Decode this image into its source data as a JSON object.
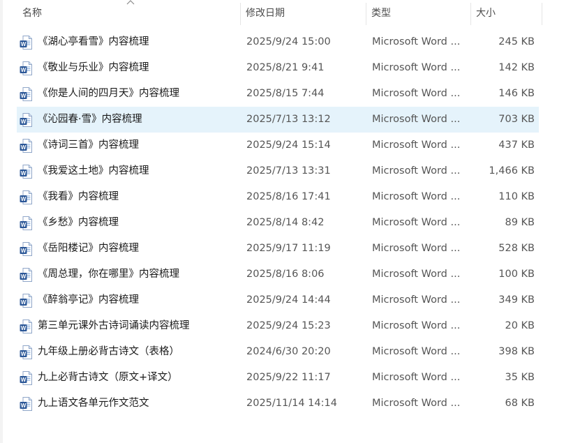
{
  "header": {
    "name": "名称",
    "date": "修改日期",
    "type": "类型",
    "size": "大小"
  },
  "icons": {
    "file": "word-document-icon",
    "sort": "sort-ascending-chevron-icon"
  },
  "colors": {
    "selected_row": "#e5f3fb",
    "word_blue": "#2b5797"
  },
  "selected_index": 3,
  "files": [
    {
      "name": "《湖心亭看雪》内容梳理",
      "date": "2025/9/24 15:00",
      "type": "Microsoft Word ...",
      "size": "245 KB"
    },
    {
      "name": "《敬业与乐业》内容梳理",
      "date": "2025/8/21 9:41",
      "type": "Microsoft Word ...",
      "size": "142 KB"
    },
    {
      "name": "《你是人间的四月天》内容梳理",
      "date": "2025/8/15 7:44",
      "type": "Microsoft Word ...",
      "size": "146 KB"
    },
    {
      "name": "《沁园春·雪》内容梳理",
      "date": "2025/7/13 13:12",
      "type": "Microsoft Word ...",
      "size": "703 KB"
    },
    {
      "name": "《诗词三首》内容梳理",
      "date": "2025/9/24 15:14",
      "type": "Microsoft Word ...",
      "size": "437 KB"
    },
    {
      "name": "《我爱这土地》内容梳理",
      "date": "2025/7/13 13:31",
      "type": "Microsoft Word ...",
      "size": "1,466 KB"
    },
    {
      "name": "《我看》内容梳理",
      "date": "2025/8/16 17:41",
      "type": "Microsoft Word ...",
      "size": "110 KB"
    },
    {
      "name": "《乡愁》内容梳理",
      "date": "2025/8/14 8:42",
      "type": "Microsoft Word ...",
      "size": "89 KB"
    },
    {
      "name": "《岳阳楼记》内容梳理",
      "date": "2025/9/17 11:19",
      "type": "Microsoft Word ...",
      "size": "528 KB"
    },
    {
      "name": "《周总理，你在哪里》内容梳理",
      "date": "2025/8/16 8:06",
      "type": "Microsoft Word ...",
      "size": "100 KB"
    },
    {
      "name": "《醉翁亭记》内容梳理",
      "date": "2025/9/24 14:44",
      "type": "Microsoft Word ...",
      "size": "349 KB"
    },
    {
      "name": "第三单元课外古诗词诵读内容梳理",
      "date": "2025/9/24 15:23",
      "type": "Microsoft Word ...",
      "size": "20 KB"
    },
    {
      "name": "九年级上册必背古诗文（表格）",
      "date": "2024/6/30 20:20",
      "type": "Microsoft Word ...",
      "size": "398 KB"
    },
    {
      "name": "九上必背古诗文（原文+译文）",
      "date": "2025/9/22 11:17",
      "type": "Microsoft Word ...",
      "size": "35 KB"
    },
    {
      "name": "九上语文各单元作文范文",
      "date": "2025/11/14 14:14",
      "type": "Microsoft Word ...",
      "size": "68 KB"
    }
  ]
}
